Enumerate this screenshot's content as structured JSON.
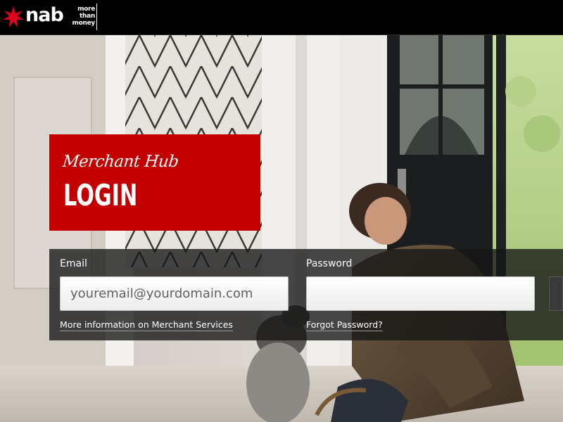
{
  "header": {
    "logo_text": "nab",
    "tagline": [
      "more",
      "than",
      "money"
    ]
  },
  "title_card": {
    "subtitle": "Merchant Hub",
    "title": "LOGIN",
    "color": "#c20000"
  },
  "login": {
    "email_label": "Email",
    "email_placeholder": "youremail@yourdomain.com",
    "email_value": "",
    "password_label": "Password",
    "password_value": "",
    "info_link": "More information on Merchant Services",
    "forgot_link": "Forgot Password?"
  },
  "icons": {
    "logo_star": "nab-star-icon"
  }
}
